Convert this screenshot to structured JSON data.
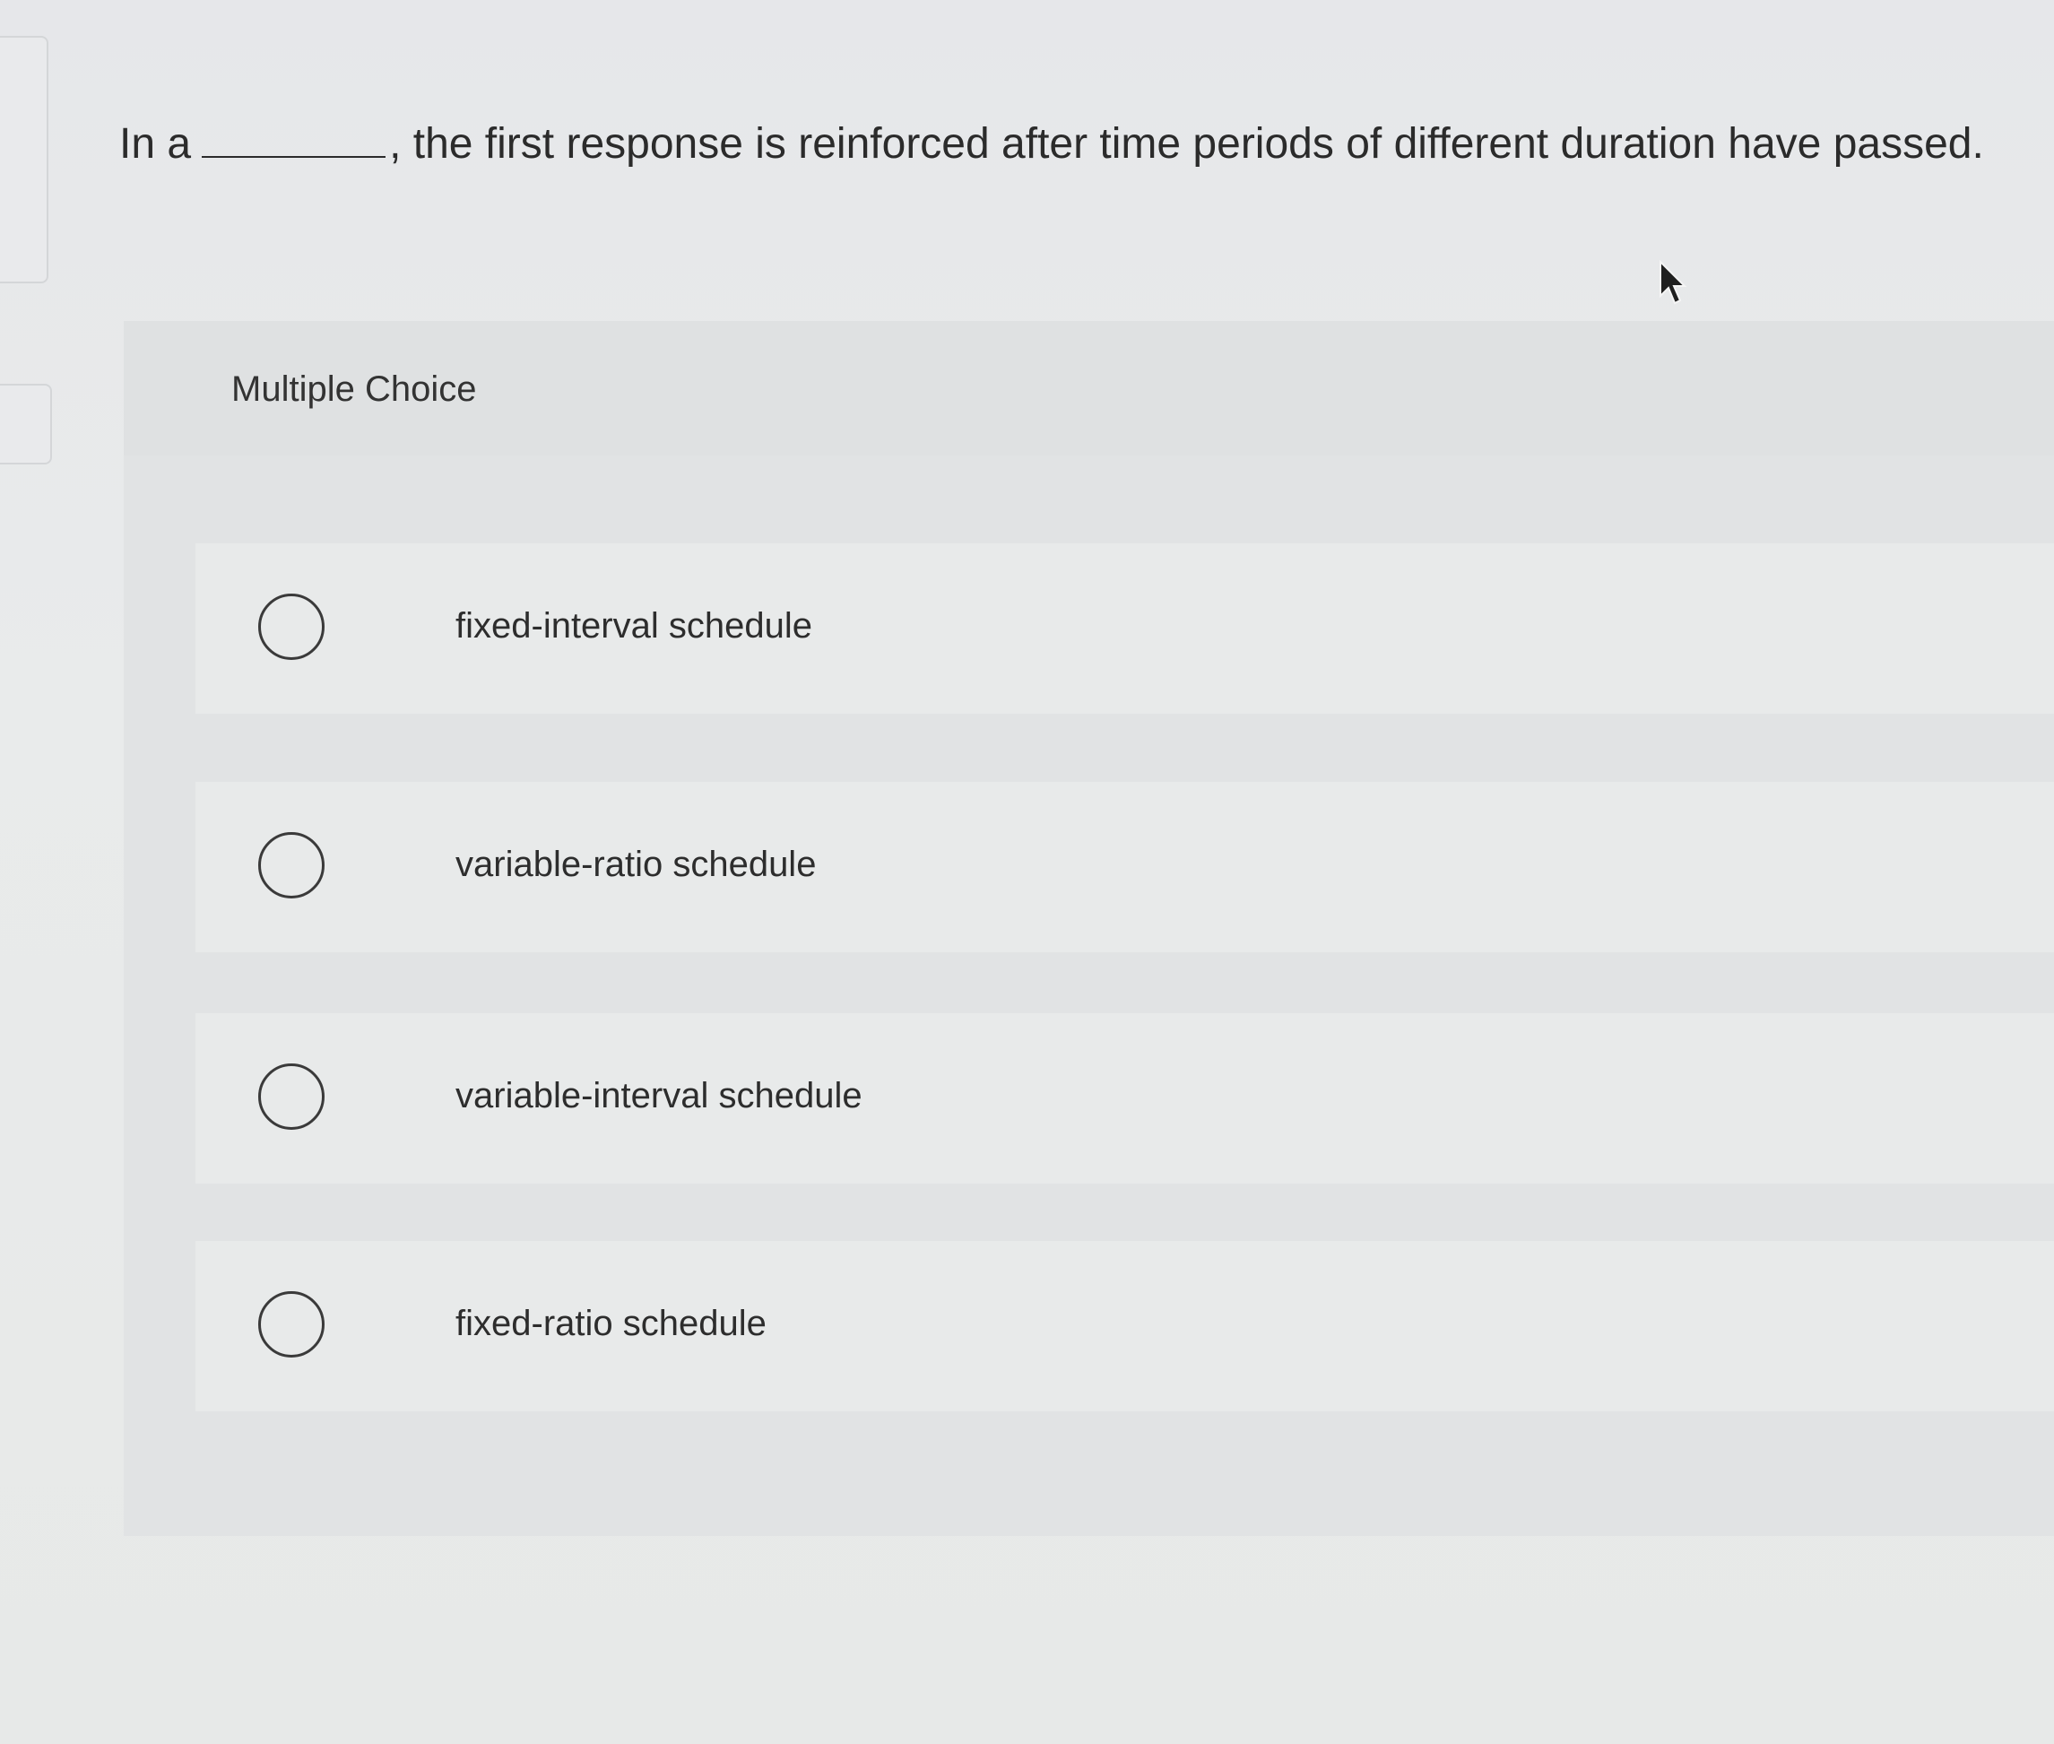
{
  "question": {
    "prefix": "In a",
    "suffix": ", the first response is reinforced after time periods of different duration have passed."
  },
  "multiple_choice": {
    "title": "Multiple Choice",
    "options": [
      {
        "label": "fixed-interval schedule"
      },
      {
        "label": "variable-ratio schedule"
      },
      {
        "label": "variable-interval schedule"
      },
      {
        "label": "fixed-ratio schedule"
      }
    ]
  },
  "icons": {
    "cursor": "mouse-pointer-icon",
    "radio": "radio-unselected-icon"
  },
  "colors": {
    "text": "#2b2b2b",
    "card_background": "#e1e3e4",
    "option_background": "#e8eaea"
  }
}
